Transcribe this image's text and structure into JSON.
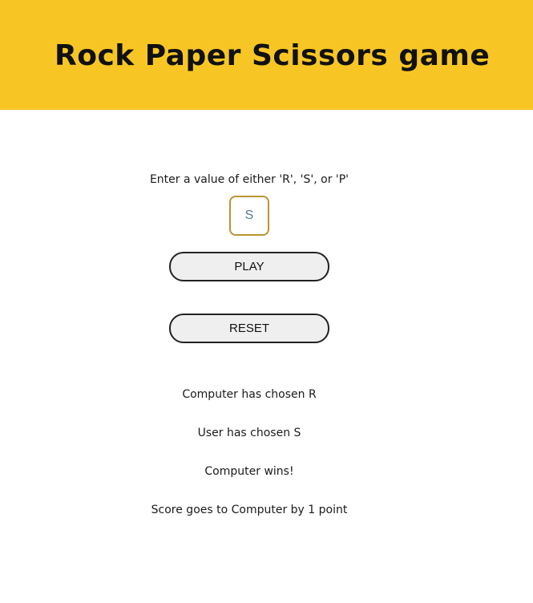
{
  "header": {
    "title": "Rock Paper Scissors game"
  },
  "game": {
    "prompt": "Enter a value of either 'R', 'S', or 'P'",
    "input_value": "S",
    "play_label": "PLAY",
    "reset_label": "RESET"
  },
  "results": {
    "computer_choice": "Computer has chosen R",
    "user_choice": "User has chosen S",
    "winner": "Computer wins!",
    "score": "Score goes to Computer by 1 point"
  },
  "colors": {
    "header_bg": "#f7c625",
    "input_border": "#b99434",
    "input_text": "#4d7a8c",
    "button_bg": "#efefef"
  }
}
